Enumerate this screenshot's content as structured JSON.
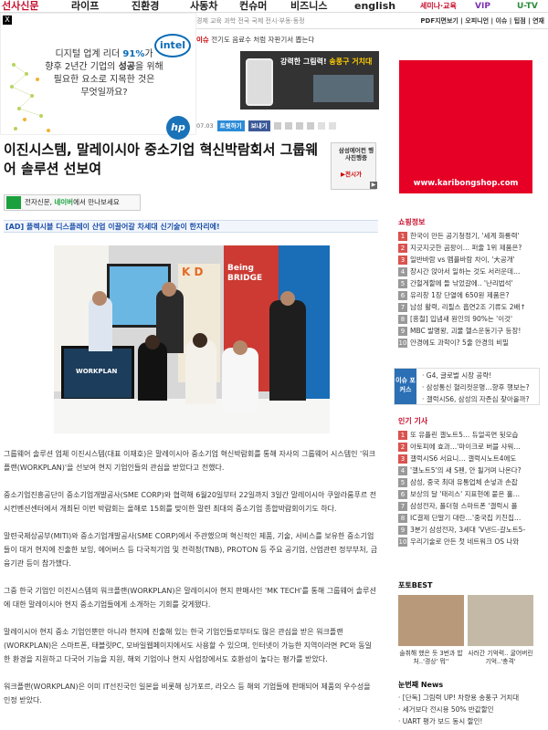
{
  "topnav": {
    "items": [
      "선사신문",
      "라이프",
      "진환경",
      "사동차",
      "컨슈머",
      "비즈니스",
      "english"
    ],
    "right": [
      "세미나·교육",
      "VIP",
      "U-TV"
    ]
  },
  "subnav": {
    "text": "경제 교육 과학    전국    국제    전시·부동·동정",
    "right": "PDF지면보기 | 오피니언 | 이슈 | 팁점 | 연재"
  },
  "breaking": {
    "tag": "이슈",
    "text": "전기도 음료수 처럼 자판기서 뽑는다"
  },
  "ad_intel": {
    "close": "X",
    "line1": "디지털 업계 리더",
    "pct": "91%",
    "line1b": "가",
    "line2": "향후 2년간 기업의",
    "bold": "성공",
    "line2b": "을 위해",
    "line3": "필요한 요소로 지목한 것은",
    "line4": "무엇일까요?",
    "intel": "intel",
    "hp": "hp"
  },
  "ad_phone": {
    "title": "강력한 그림력!",
    "hl": "송풍구 거치대"
  },
  "toolbar": {
    "date": "07.03",
    "btn1": "트윗하기",
    "btn2": "보내기"
  },
  "headline": "이진시스템, 말레이시아 중소기업 혁신박람회서 그룹웨어 솔루션 선보여",
  "side_banner": {
    "text": "삼성에어컨 행사진행중",
    "buy": "▶전시가"
  },
  "naver_btn": {
    "pre": "전자신문,",
    "nv": "네이버",
    "post": "에서 만나보세요"
  },
  "ad_banner": "[AD] 플렉시블 디스플레이 산업 이끌어갈 차세대 신기술이 한자리에!",
  "photo": {
    "bridge": "Being BRIDGE",
    "letters": "K D",
    "screen": "WORKPLAN"
  },
  "body": [
    "그룹웨어 솔루션 업체 이진시스템(대표 이재호)은 말레이시아 중소기업 혁신박람회를 통해 자사의 그룹웨어 시스템인 '워크플랜(WORKPLAN)'을 선보여 현지 기업인들의 관심을 받았다고 전했다.",
    "중소기업진흥공단이 중소기업개발공사(SME CORP)와 협력해 6월20일부터 22일까지 3일간 말레이시아 쿠알라룸푸르 전시컨벤션센터에서 개최된 이번 박람회는 올해로 15회를 맞이한 말련 최대의 중소기업 종합박람회이기도 하다.",
    "말련국제상공부(MITI)와 중소기업개발공사(SME CORP)에서 주관했으며 혁신적인 제품, 기술, 서비스를 보유한 중소기업들이 대거 현지에 진출한 보잉, 에어버스 등 다국적기업 및 전력청(TNB), PROTON 등 주요 공기업, 산업관련 정부부처, 금융기관 등이 참가했다.",
    "그중 한국 기업인 이진시스템의 워크플랜(WORKPLAN)은 말레이시아 현지 판매사인 'MK TECH'를 통해 그룹웨어 솔루션에 대한 말레이시아 현지 중소기업들에게 소개하는 기회를 갖게됐다.",
    "말레이시아 현지 중소 기업인뿐만 아니라 현지에 진출해 있는 한국 기업인들로부터도 많은 관심을 받은 워크플랜(WORKPLAN)은 스마트폰, 태블릿PC, 모바일웹페이지에서도 사용할 수 있으며, 인터넷이 가능한 지역이라면 PC와 동일한 환경을 지원하고 다국어 기능을 지원, 해외 기업이나 현지 사업장에서도 호환성이 높다는 평가를 받았다.",
    "워크플랜(WORKPLAN)은 이미 IT선진국인 일본을 비롯해 싱가포르, 라오스 등 해외 기업들에 판매되어 제품의 우수성을 인정 받았다."
  ],
  "red_ad": {
    "url": "www.karibongshop.com"
  },
  "shopping": {
    "title": "쇼핑정보",
    "items": [
      "한국이 만든 공기청정기, '세계 화룡력'",
      "지긋지긋한 곰팡이… 퍼줄 1위 제품은?",
      "일반바람 vs 멤플바람 차이, '大공개'",
      "장시간 앉아서 일하는 것도 서러운데…",
      "간헐게할에 들 낚었갈에.. '난리법석'",
      "유리창 1장 단열에 650원 제품은?",
      "남성 활력, 리필스 흡연2조 기류도 2배↑",
      "[흥철] 입냄새 원인의 90%는 '이것'",
      "MBC 발명왕, 괴물 헬스운동기구 등장!",
      "안경에도 과학이? 5줄 안경의 비밀"
    ]
  },
  "issue": {
    "label": "이슈 포커스",
    "items": [
      "G4, 글로벌 시장 공략!",
      "삼성통신 혈리컷운명…향후 행보는?",
      "갤럭시S6, 삼성의 자존심 찾아올까?"
    ]
  },
  "popular": {
    "title": "인기 기사",
    "items": [
      "또 유플린 갤노트5… 듀얼곡면 뒷모습",
      "아토피에 효과…'마이크로 버블 샤워…",
      "갤럭시S6 서요니… 갤럭시노트4에도",
      "'갤노트5'의 새 S펜, 안 될거며 나온다?",
      "삼성, 중국 최대 유통업체 손넣과 손잡",
      "보상의 달 '태리스' 지표현에 붙은 홀…",
      "삼성전자, 폴더형 스마트폰 '갤럭시 폴",
      "IC결제 단말기 대란…'중국집 키친집…",
      "3분기 삼성전자, 3세대 'V낸드-갈노트5-",
      "우리기술로 만든 첫 네트워크 OS 나와"
    ]
  },
  "photobest": {
    "title": "포토BEST",
    "cap1": "술취해 했은 듯 3번과 밥처..'경상' 뭐''",
    "cap2": "사러간 기억력.. 굴어버린 기억..'충격'"
  },
  "must": {
    "title": "눈번째 News",
    "items": [
      "[단독] 그림력 UP! 차량용 송풍구 거치대",
      "세거보다 전시용 50% 반값할인",
      "UART 평가 보드 동시 할인!"
    ]
  },
  "colors": {
    "brand_red": "#c8102e",
    "accent_blue": "#1b4fa8",
    "ad_red": "#e60026"
  }
}
